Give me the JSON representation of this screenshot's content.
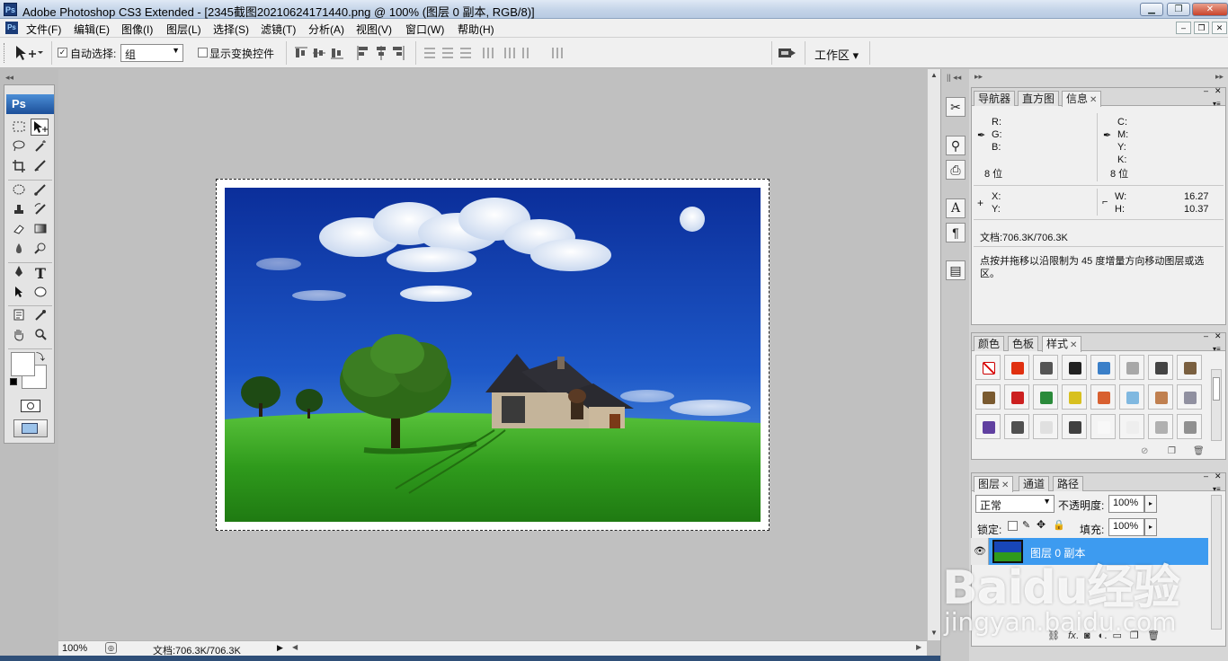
{
  "window": {
    "title": "Adobe Photoshop CS3 Extended - [2345截图20210624171440.png @ 100% (图层 0 副本, RGB/8)]",
    "app_icon": "Ps",
    "min_label": "▁",
    "restore_label": "❐",
    "close_label": "✕",
    "mdi_min": "–",
    "mdi_restore": "❐",
    "mdi_close": "✕"
  },
  "menu": [
    "文件(F)",
    "编辑(E)",
    "图像(I)",
    "图层(L)",
    "选择(S)",
    "滤镜(T)",
    "分析(A)",
    "视图(V)",
    "窗口(W)",
    "帮助(H)"
  ],
  "options": {
    "auto_select_label": "自动选择:",
    "auto_select_checked": "✓",
    "auto_select_value": "组",
    "show_transform_label": "显示变换控件",
    "workspace_label": "工作区 ▾"
  },
  "toolbox": {
    "logo": "Ps",
    "tools": [
      "move-tool",
      "marquee-tool",
      "lasso-tool",
      "magic-wand-tool",
      "crop-tool",
      "slice-tool",
      "healing-brush-tool",
      "brush-tool",
      "clone-stamp-tool",
      "history-brush-tool",
      "eraser-tool",
      "gradient-tool",
      "blur-tool",
      "dodge-tool",
      "pen-tool",
      "type-tool",
      "path-selection-tool",
      "shape-tool",
      "notes-tool",
      "eyedropper-tool",
      "hand-tool",
      "zoom-tool"
    ],
    "type_tool_glyph": "T"
  },
  "status": {
    "zoom": "100%",
    "doc": "文档:706.3K/706.3K"
  },
  "info_panel": {
    "tabs": [
      "导航器",
      "直方图",
      "信息"
    ],
    "active_tab": "信息",
    "r": "R:",
    "g": "G:",
    "b": "B:",
    "c": "C:",
    "m": "M:",
    "y": "Y:",
    "k": "K:",
    "bits_left": "8 位",
    "bits_right": "8 位",
    "x": "X:",
    "yy": "Y:",
    "w": "W:",
    "h": "H:",
    "w_val": "16.27",
    "h_val": "10.37",
    "doc": "文档:706.3K/706.3K",
    "hint": "点按并拖移以沿限制为 45 度增量方向移动图层或选区。"
  },
  "styles_panel": {
    "tabs": [
      "颜色",
      "色板",
      "样式"
    ],
    "active_tab": "样式",
    "swatch_colors": [
      "#ffffff",
      "#e03010",
      "#555555",
      "#222222",
      "#3a7fc8",
      "#a8a8a8",
      "#444444",
      "#7a6040",
      "#7a5a30",
      "#cc2020",
      "#2a8a3a",
      "#d8c020",
      "#d86030",
      "#80b8e0",
      "#c08050",
      "#9090a0",
      "#6040a0",
      "#505050",
      "#e0e0e0",
      "#404040",
      "#f8f8f8",
      "#eeeeee",
      "#b0b0b0",
      "#909090"
    ]
  },
  "layers_panel": {
    "tabs": [
      "图层",
      "通道",
      "路径"
    ],
    "active_tab": "图层",
    "blend_mode": "正常",
    "opacity_label": "不透明度:",
    "opacity_value": "100%",
    "lock_label": "锁定:",
    "fill_label": "填充:",
    "fill_value": "100%",
    "layer_name": "图层 0 副本"
  },
  "watermark": {
    "brand": "Baidu经验",
    "url": "jingyan.baidu.com"
  },
  "colors": {
    "accent": "#3d9bf0",
    "sky": "#1846b8",
    "grass": "#2f9a1c"
  }
}
